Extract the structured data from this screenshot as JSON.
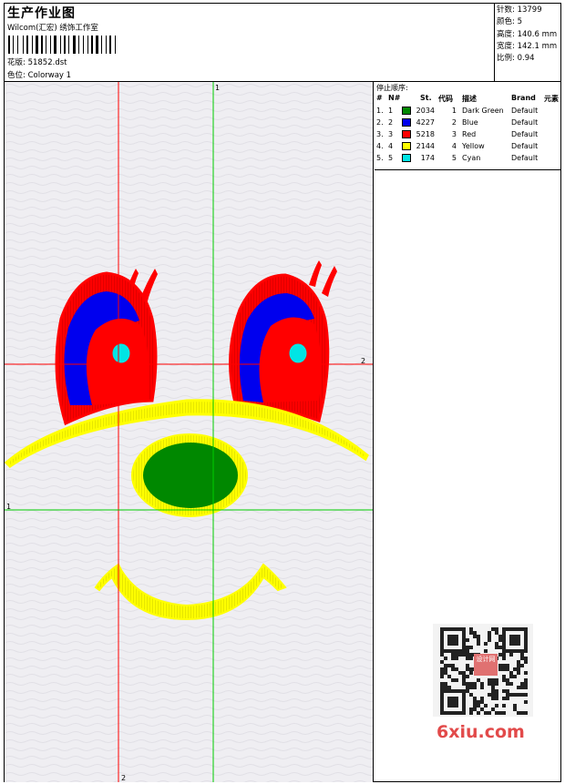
{
  "header": {
    "title": "生产作业图",
    "company": "Wilcom(汇宏) 绣饰工作室",
    "design_label": "花版:",
    "design_value": "51852.dst",
    "colorway_label": "色位:",
    "colorway_value": "Colorway 1"
  },
  "specs": {
    "stitches_label": "针数:",
    "stitches_value": "13799",
    "colors_label": "颜色:",
    "colors_value": "5",
    "height_label": "高度:",
    "height_value": "140.6 mm",
    "width_label": "宽度:",
    "width_value": "142.1 mm",
    "scale_label": "比例:",
    "scale_value": "0.94"
  },
  "stops": {
    "title": "停止顺序:",
    "columns": [
      "#",
      "N#",
      "St.",
      "代码",
      "描述",
      "Brand",
      "元素"
    ],
    "rows": [
      {
        "idx": "1.",
        "n": "1",
        "stitches": "2034",
        "code": "1",
        "desc": "Dark Green",
        "brand": "Default",
        "color": "#008800"
      },
      {
        "idx": "2.",
        "n": "2",
        "stitches": "4227",
        "code": "2",
        "desc": "Blue",
        "brand": "Default",
        "color": "#0000ee"
      },
      {
        "idx": "3.",
        "n": "3",
        "stitches": "5218",
        "code": "3",
        "desc": "Red",
        "brand": "Default",
        "color": "#ff0000"
      },
      {
        "idx": "4.",
        "n": "4",
        "stitches": "2144",
        "code": "4",
        "desc": "Yellow",
        "brand": "Default",
        "color": "#ffff00"
      },
      {
        "idx": "5.",
        "n": "5",
        "stitches": "174",
        "code": "5",
        "desc": "Cyan",
        "brand": "Default",
        "color": "#00e5e5"
      }
    ]
  },
  "guides": {
    "top_marker": "1",
    "right_marker": "2",
    "left_marker": "1",
    "bottom_marker": "2"
  },
  "colors": {
    "guide_red": "#ff0000",
    "guide_green": "#00cc00"
  },
  "watermark": {
    "mark_text": "设计网",
    "brand": "6xiu.com"
  }
}
